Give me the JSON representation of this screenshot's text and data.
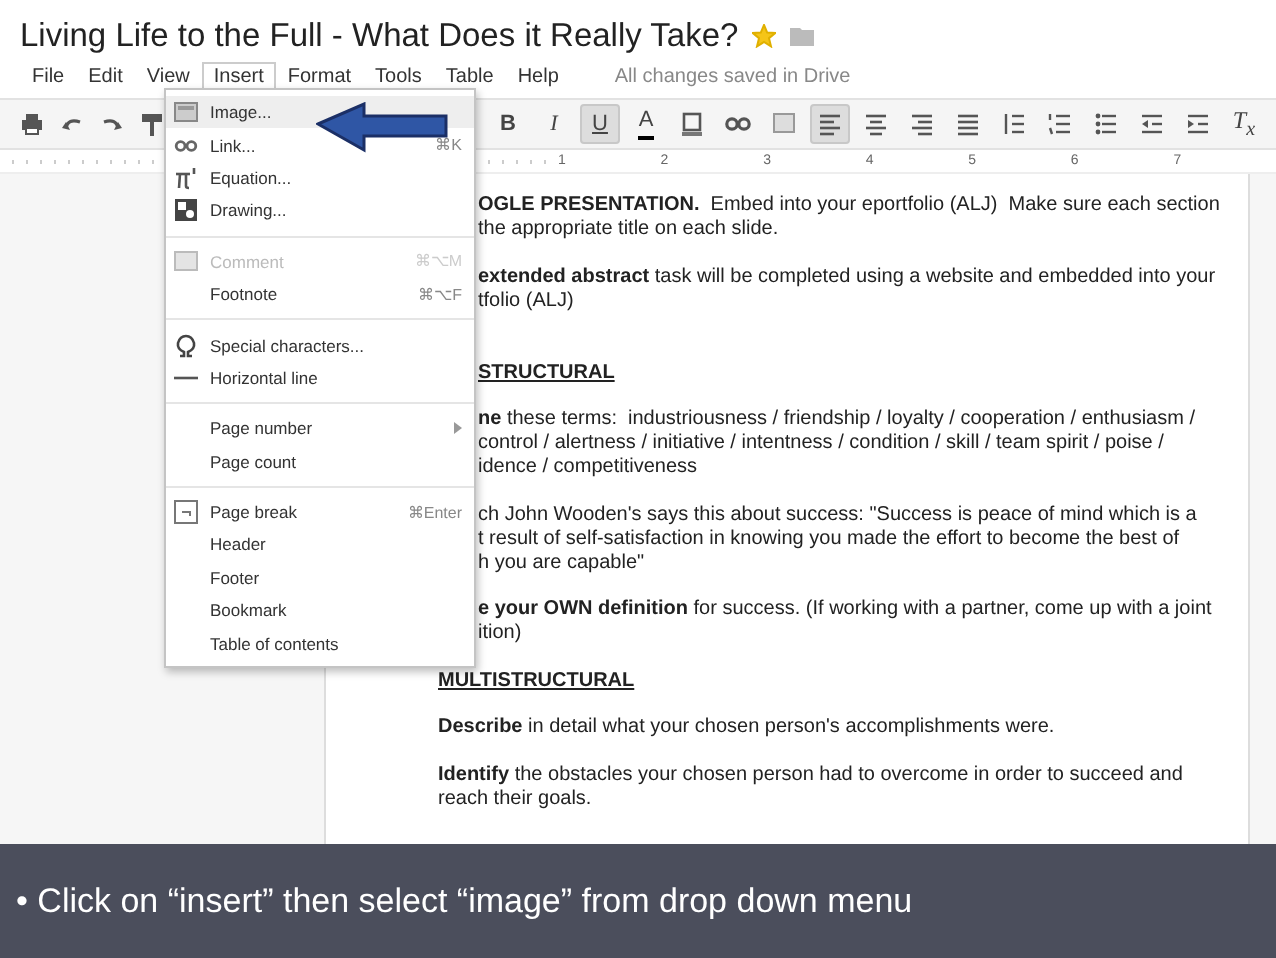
{
  "window": {
    "title": "Living Life to the Full - What Does it Really Take?",
    "starred": true
  },
  "menubar": {
    "items": [
      {
        "label": "File",
        "selected": false
      },
      {
        "label": "Edit",
        "selected": false
      },
      {
        "label": "View",
        "selected": false
      },
      {
        "label": "Insert",
        "selected": true
      },
      {
        "label": "Format",
        "selected": false
      },
      {
        "label": "Tools",
        "selected": false
      },
      {
        "label": "Table",
        "selected": false
      },
      {
        "label": "Help",
        "selected": false
      }
    ],
    "status": "All changes saved in Drive"
  },
  "toolbar": {
    "items": [
      {
        "kind": "text",
        "label": "B",
        "selected": false
      },
      {
        "kind": "text",
        "label": "I",
        "selected": false
      },
      {
        "kind": "text",
        "label": "U",
        "selected": true
      },
      {
        "kind": "text",
        "label": "A",
        "selected": false
      },
      {
        "kind": "icon",
        "selected": false
      },
      {
        "kind": "icon",
        "selected": false
      },
      {
        "kind": "icon",
        "selected": false
      },
      {
        "kind": "icon",
        "selected": true
      },
      {
        "kind": "icon",
        "selected": false
      },
      {
        "kind": "icon",
        "selected": false
      },
      {
        "kind": "icon",
        "selected": false
      },
      {
        "kind": "icon",
        "selected": false
      },
      {
        "kind": "icon",
        "selected": false
      },
      {
        "kind": "icon",
        "selected": false
      },
      {
        "kind": "icon",
        "selected": false
      },
      {
        "kind": "icon",
        "selected": false
      },
      {
        "kind": "text",
        "label": "T$_{x}$",
        "selected": false
      }
    ]
  },
  "ruler": {
    "labels": [
      "1",
      "2",
      "3",
      "4",
      "5",
      "6",
      "7"
    ]
  },
  "insert_menu": {
    "groups": [
      [
        {
          "label": "Image...",
          "selected": true,
          "disabled": false,
          "submenu": false
        },
        {
          "label": "Link...",
          "shortcut": "⌘K",
          "selected": false,
          "disabled": false,
          "submenu": false
        },
        {
          "label": "Equation...",
          "selected": false,
          "disabled": false,
          "submenu": false
        },
        {
          "label": "Drawing...",
          "selected": false,
          "disabled": false,
          "submenu": false
        }
      ],
      [
        {
          "label": "Comment",
          "shortcut": "⌘⌥M",
          "selected": false,
          "disabled": true,
          "submenu": false
        },
        {
          "label": "Footnote",
          "shortcut": "⌘⌥F",
          "selected": false,
          "disabled": false,
          "submenu": false
        }
      ],
      [
        {
          "label": "Special characters...",
          "selected": false,
          "disabled": false,
          "submenu": false
        },
        {
          "label": "Horizontal line",
          "selected": false,
          "disabled": false,
          "submenu": false
        }
      ],
      [
        {
          "label": "Page number",
          "selected": false,
          "disabled": false,
          "submenu": true
        },
        {
          "label": "Page count",
          "selected": false,
          "disabled": false,
          "submenu": false
        }
      ],
      [
        {
          "label": "Page break",
          "shortcut": "⌘Enter",
          "selected": false,
          "disabled": false,
          "submenu": false
        },
        {
          "label": "Header",
          "selected": false,
          "disabled": false,
          "submenu": false
        },
        {
          "label": "Footer",
          "selected": false,
          "disabled": false,
          "submenu": false
        },
        {
          "label": "Bookmark",
          "selected": false,
          "disabled": false,
          "submenu": false
        },
        {
          "label": "Table of contents",
          "selected": false,
          "disabled": false,
          "submenu": false
        }
      ]
    ]
  },
  "document": {
    "blocks": [
      {
        "kind": "paragraph",
        "clipped": true,
        "lines": [
          "**OGLE PRESENTATION.**  Embed into your eportfolio (ALJ)  Make sure each section",
          "the appropriate title on each slide."
        ]
      },
      {
        "kind": "paragraph",
        "clipped": true,
        "lines": [
          "**extended abstract** task will be completed using a website and embedded into your",
          "tfolio (ALJ)"
        ]
      },
      {
        "kind": "heading",
        "clipped": true,
        "lines": [
          "STRUCTURAL"
        ]
      },
      {
        "kind": "paragraph",
        "clipped": true,
        "lines": [
          "**ne** these terms:  industriousness / friendship / loyalty / cooperation / enthusiasm /",
          "control / alertness / initiative / intentness / condition / skill / team spirit / poise /",
          "idence / competitiveness"
        ]
      },
      {
        "kind": "paragraph",
        "clipped": true,
        "lines": [
          "ch John Wooden's says this about success: \"Success is peace of mind which is a",
          "t result of self-satisfaction in knowing you made the effort to become the best of",
          "h you are capable\""
        ]
      },
      {
        "kind": "paragraph",
        "clipped": true,
        "lines": [
          "**e your OWN definition** for success. (If working with a partner, come up with a joint",
          "ition)"
        ]
      },
      {
        "kind": "heading",
        "clipped": false,
        "lines": [
          "MULTISTRUCTURAL"
        ]
      },
      {
        "kind": "paragraph",
        "clipped": false,
        "lines": [
          "**Describe** in detail what your chosen person's accomplishments were."
        ]
      },
      {
        "kind": "paragraph",
        "clipped": false,
        "lines": [
          "**Identify** the obstacles your chosen person had to overcome in order to succeed and",
          "reach their goals."
        ]
      }
    ]
  },
  "caption": "• Click on “insert” then select “image” from drop down menu"
}
